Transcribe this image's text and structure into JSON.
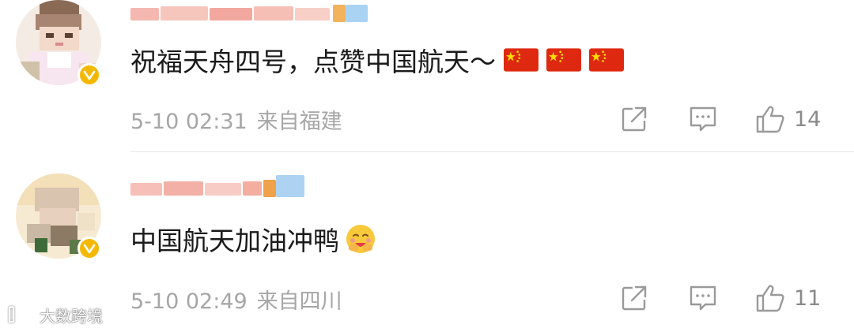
{
  "comments": [
    {
      "text": "祝福天舟四号，点赞中国航天～",
      "emoji_names": [
        "china-flag-icon",
        "china-flag-icon",
        "china-flag-icon"
      ],
      "date": "5-10 02:31",
      "location": "来自福建",
      "like_count": "14",
      "verified": true
    },
    {
      "text": "中国航天加油冲鸭",
      "emoji_names": [
        "hugging-face-emoji-icon"
      ],
      "date": "5-10 02:49",
      "location": "来自四川",
      "like_count": "11",
      "verified": true
    }
  ],
  "watermark": {
    "text": "大数跨境"
  },
  "colors": {
    "text": "#1a1a1a",
    "meta": "#a6a6a6",
    "icon": "#9a9a9a",
    "verified_badge": "#f5b800",
    "flag_red": "#de2910",
    "flag_star": "#ffde00"
  }
}
